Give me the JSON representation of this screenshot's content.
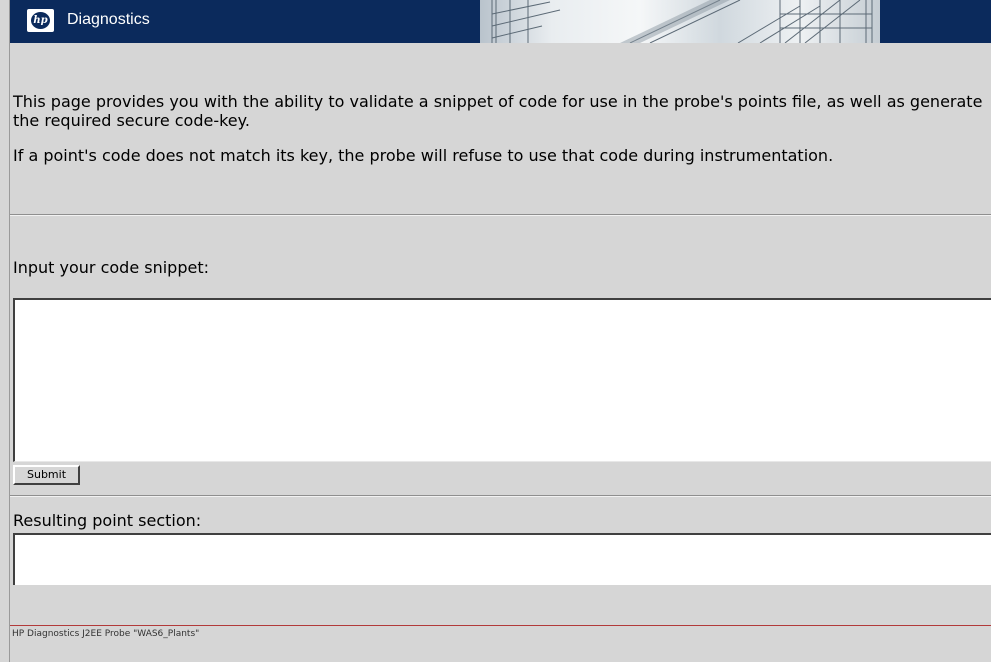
{
  "header": {
    "logo_text": "hp",
    "title": "Diagnostics"
  },
  "intro": {
    "paragraph1": "This page provides you with the ability to validate a snippet of code for use in the probe's points file, as well as generate the required secure code-key.",
    "paragraph2": "If a point's code does not match its key, the probe will refuse to use that code during instrumentation."
  },
  "form": {
    "code_label": "Input your code snippet:",
    "code_value": "",
    "submit_label": "Submit",
    "result_label": "Resulting point section:",
    "result_value": ""
  },
  "footer": {
    "text": "HP Diagnostics J2EE Probe \"WAS6_Plants\""
  },
  "colors": {
    "header_bg": "#0b2a5c",
    "page_bg": "#d6d6d6",
    "footer_rule": "#b23a3a"
  }
}
